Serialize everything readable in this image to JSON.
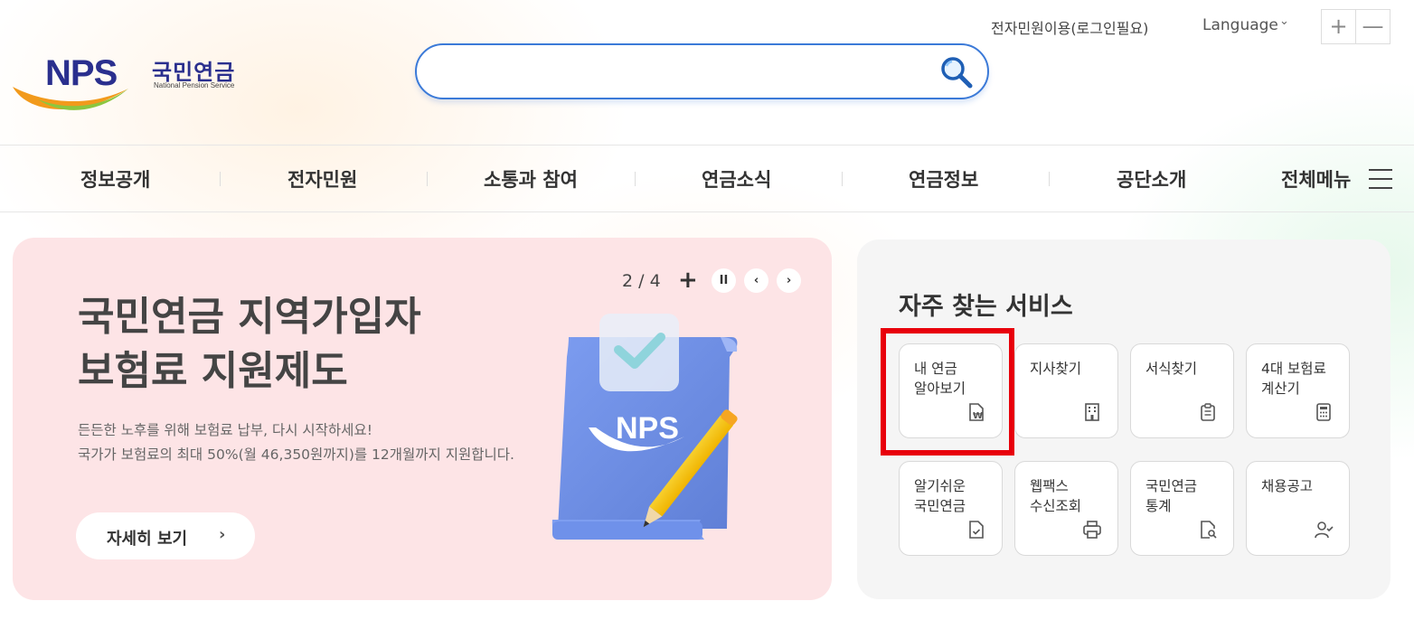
{
  "header": {
    "logo_text_ko": "국민연금",
    "logo_text_en": "National Pension Service",
    "search_placeholder": "",
    "util_civil": "전자민원이용(로그인필요)",
    "util_language": "Language",
    "zoom_in": "+",
    "zoom_out": "—"
  },
  "gnb": {
    "items": [
      "정보공개",
      "전자민원",
      "소통과 참여",
      "연금소식",
      "연금정보",
      "공단소개"
    ],
    "all_menu": "전체메뉴"
  },
  "banner": {
    "title_line1": "국민연금 지역가입자",
    "title_line2": "보험료 지원제도",
    "desc_line1": "든든한 노후를 위해 보험료 납부, 다시 시작하세요!",
    "desc_line2": "국가가 보험료의 최대 50%(월 46,350원까지)를 12개월까지 지원합니다.",
    "more_label": "자세히 보기",
    "more_arrow": "›",
    "pager": "2 / 4",
    "plus": "+",
    "pause": "II",
    "prev": "‹",
    "next": "›",
    "illust_logo": "NPS",
    "colors": {
      "bg": "#fde4e6",
      "doc": "#6f8fe0"
    }
  },
  "quick": {
    "title": "자주 찾는 서비스",
    "services": [
      {
        "label": "내 연금\n알아보기",
        "icon": "won-document-icon"
      },
      {
        "label": "지사찾기",
        "icon": "building-icon"
      },
      {
        "label": "서식찾기",
        "icon": "clipboard-icon"
      },
      {
        "label": "4대 보험료\n계산기",
        "icon": "calculator-icon"
      },
      {
        "label": "알기쉬운\n국민연금",
        "icon": "document-check-icon"
      },
      {
        "label": "웹팩스\n수신조회",
        "icon": "printer-icon"
      },
      {
        "label": "국민연금\n통계",
        "icon": "document-search-icon"
      },
      {
        "label": "채용공고",
        "icon": "person-check-icon"
      }
    ],
    "highlight_color": "#e8000b"
  }
}
